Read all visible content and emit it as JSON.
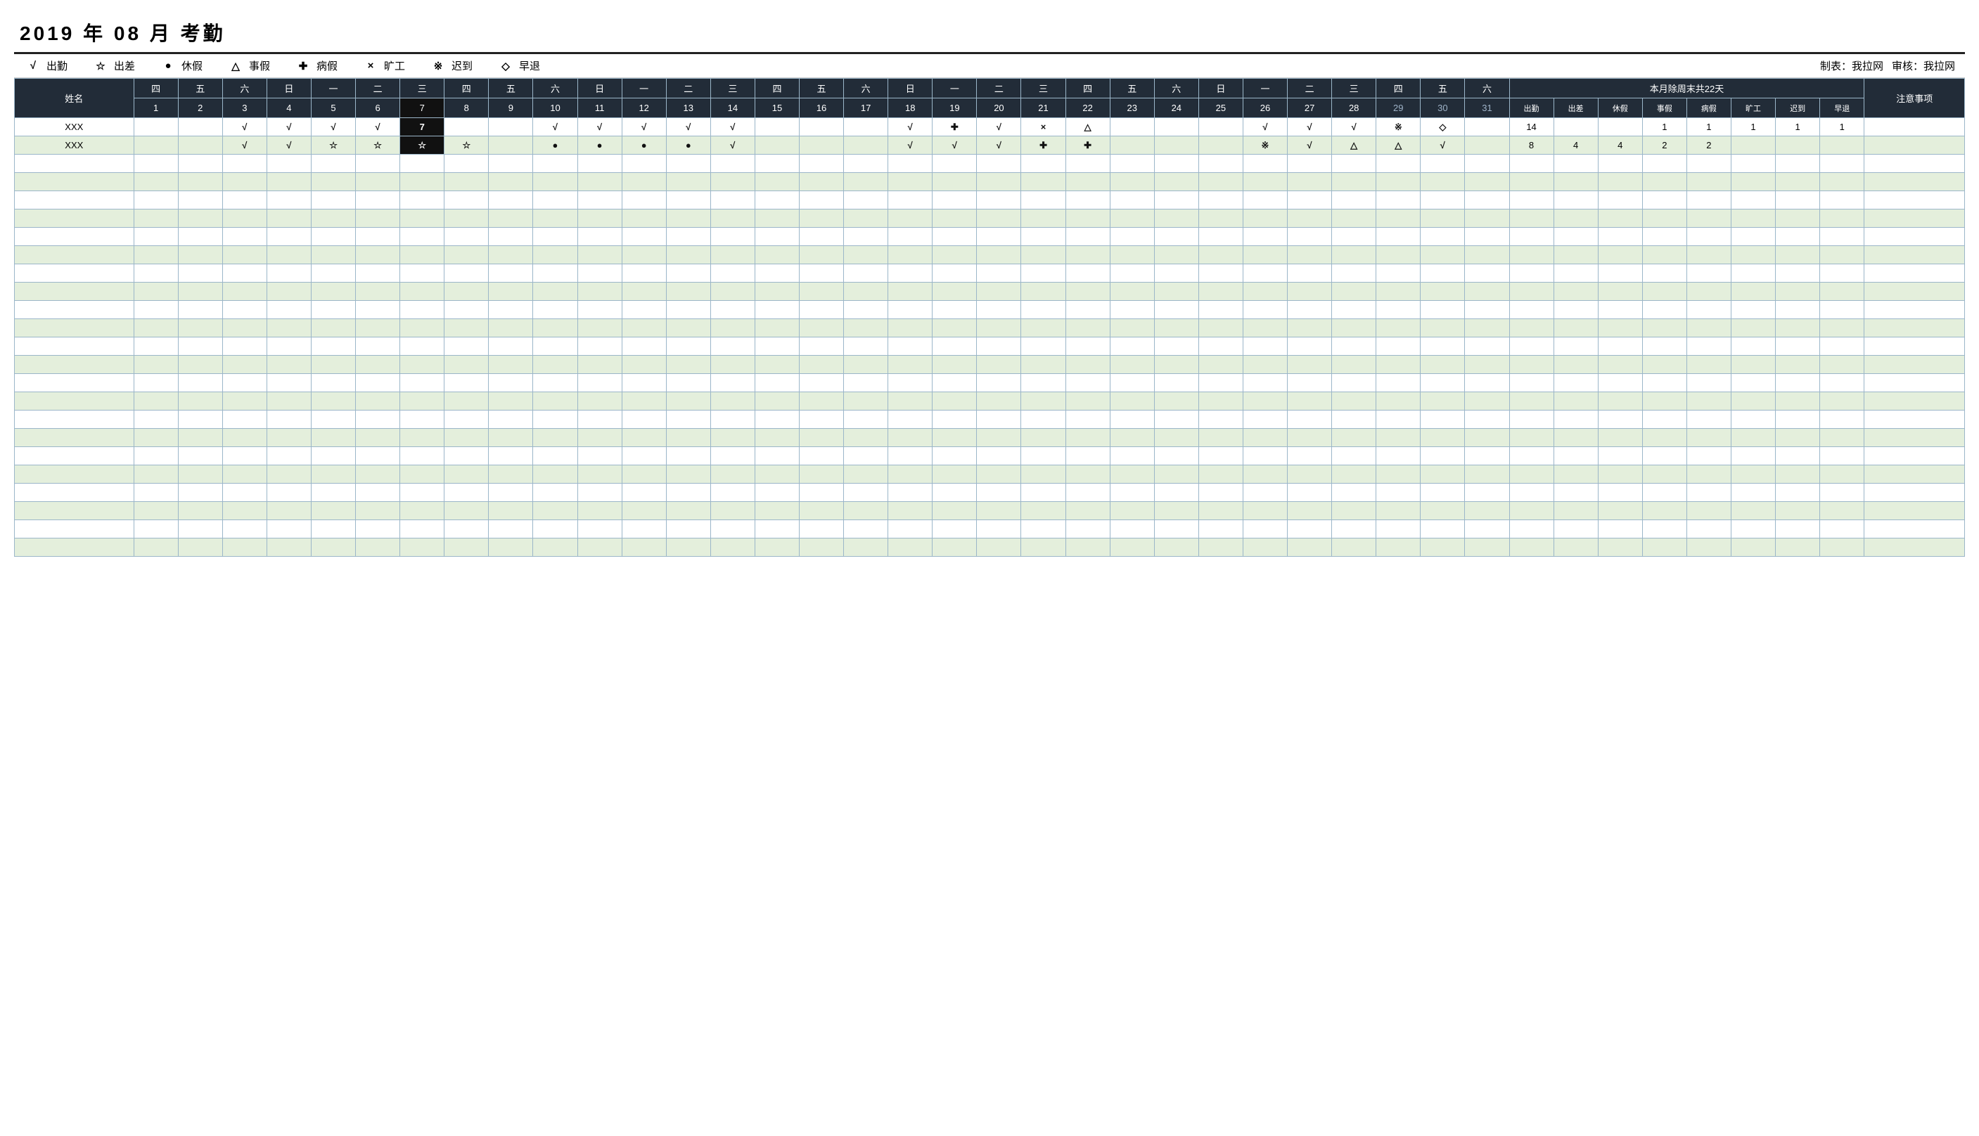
{
  "title": {
    "year": "2019",
    "y_label": "年",
    "month": "08",
    "m_label": "月",
    "suffix": "考勤"
  },
  "legend": {
    "items": [
      {
        "sym": "√",
        "label": "出勤"
      },
      {
        "sym": "☆",
        "label": "出差"
      },
      {
        "sym": "●",
        "label": "休假"
      },
      {
        "sym": "△",
        "label": "事假"
      },
      {
        "sym": "✚",
        "label": "病假"
      },
      {
        "sym": "×",
        "label": "旷工"
      },
      {
        "sym": "※",
        "label": "迟到"
      },
      {
        "sym": "◇",
        "label": "早退"
      }
    ],
    "made_by_label": "制表：",
    "made_by_value": "我拉网",
    "review_label": "审核：",
    "review_value": "我拉网"
  },
  "headers": {
    "name": "姓名",
    "weekdays": [
      "四",
      "五",
      "六",
      "日",
      "一",
      "二",
      "三",
      "四",
      "五",
      "六",
      "日",
      "一",
      "二",
      "三",
      "四",
      "五",
      "六",
      "日",
      "一",
      "二",
      "三",
      "四",
      "五",
      "六",
      "日",
      "一",
      "二",
      "三",
      "四",
      "五",
      "六"
    ],
    "days": [
      "1",
      "2",
      "3",
      "4",
      "5",
      "6",
      "7",
      "8",
      "9",
      "10",
      "11",
      "12",
      "13",
      "14",
      "15",
      "16",
      "17",
      "18",
      "19",
      "20",
      "21",
      "22",
      "23",
      "24",
      "25",
      "26",
      "27",
      "28",
      "29",
      "30",
      "31"
    ],
    "highlight_day_index": 6,
    "dim_days_from_index": 28,
    "summary_title": "本月除周末共22天",
    "summary_cols": [
      "出勤",
      "出差",
      "休假",
      "事假",
      "病假",
      "旷工",
      "迟到",
      "早退"
    ],
    "notes": "注意事项"
  },
  "rows": [
    {
      "name": "XXX",
      "marks": [
        "",
        "",
        "√",
        "√",
        "√",
        "√",
        "7",
        "",
        "",
        "√",
        "√",
        "√",
        "√",
        "√",
        "",
        "",
        "",
        "√",
        "✚",
        "√",
        "×",
        "△",
        "",
        "",
        "",
        "√",
        "√",
        "√",
        "※",
        "◇",
        ""
      ],
      "sums": [
        "14",
        "",
        "",
        "1",
        "1",
        "1",
        "1",
        "1"
      ],
      "note": ""
    },
    {
      "name": "XXX",
      "marks": [
        "",
        "",
        "√",
        "√",
        "☆",
        "☆",
        "☆",
        "☆",
        "",
        "●",
        "●",
        "●",
        "●",
        "√",
        "",
        "",
        "",
        "√",
        "√",
        "√",
        "✚",
        "✚",
        "",
        "",
        "",
        "※",
        "√",
        "△",
        "△",
        "√",
        ""
      ],
      "sums": [
        "8",
        "4",
        "4",
        "2",
        "2",
        "",
        "",
        ""
      ],
      "note": ""
    }
  ],
  "empty_rows": 22
}
